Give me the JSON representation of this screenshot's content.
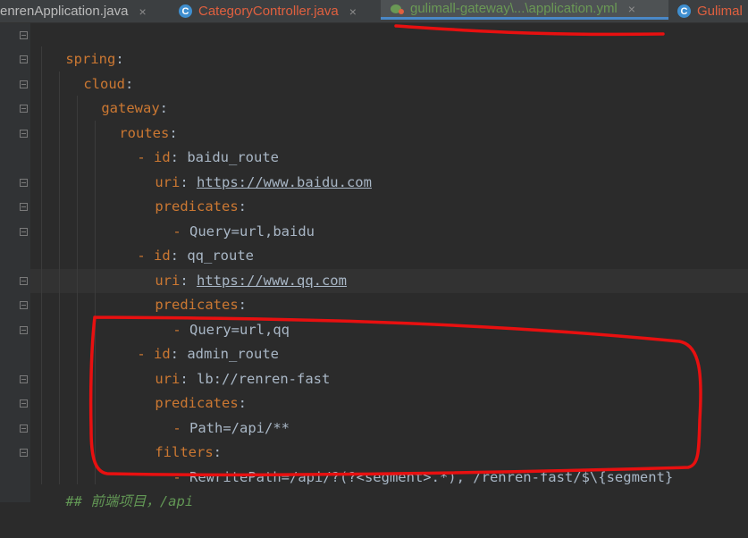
{
  "tabs": [
    {
      "label": "enrenApplication.java",
      "close": "×",
      "icon": "none"
    },
    {
      "label": "CategoryController.java",
      "close": "×",
      "icon": "class-c-icon",
      "icon_text": "C",
      "color": "#e0603f"
    },
    {
      "label": "gulimall-gateway\\...\\application.yml",
      "close": "×",
      "icon": "spring-leaf-icon",
      "color": "#6a9955",
      "active": true
    },
    {
      "label": "Gulimal",
      "icon": "class-c-icon",
      "icon_text": "C",
      "color": "#e0603f"
    }
  ],
  "colors": {
    "background": "#2b2b2b",
    "gutter": "#313335",
    "key": "#cc7832",
    "text": "#a9b7c6",
    "comment": "#629755",
    "annotation": "#e81010"
  },
  "code": {
    "l1": {
      "key": "spring",
      "colon": ":"
    },
    "l2": {
      "key": "cloud",
      "colon": ":"
    },
    "l3": {
      "key": "gateway",
      "colon": ":"
    },
    "l4": {
      "key": "routes",
      "colon": ":"
    },
    "l5": {
      "dash": "- ",
      "key": "id",
      "colon": ": ",
      "value": "baidu_route"
    },
    "l6": {
      "key": "uri",
      "colon": ": ",
      "value": "https://www.baidu.com"
    },
    "l7": {
      "key": "predicates",
      "colon": ":"
    },
    "l8": {
      "dash": "- ",
      "value": "Query=url,baidu"
    },
    "l9": {
      "dash": "- ",
      "key": "id",
      "colon": ": ",
      "value": "qq_route"
    },
    "l10": {
      "key": "uri",
      "colon": ": ",
      "value": "https://www.qq.com"
    },
    "l11": {
      "key": "predicates",
      "colon": ":"
    },
    "l12": {
      "dash": "- ",
      "value": "Query=url,qq"
    },
    "l13": {
      "dash": "- ",
      "key": "id",
      "colon": ": ",
      "value": "admin_route"
    },
    "l14": {
      "key": "uri",
      "colon": ": ",
      "value": "lb://renren-fast"
    },
    "l15": {
      "key": "predicates",
      "colon": ":"
    },
    "l16": {
      "dash": "- ",
      "value": "Path=/api/**"
    },
    "l17": {
      "key": "filters",
      "colon": ":"
    },
    "l18": {
      "dash": "- ",
      "value": "RewritePath=/api/?(?<segment>.*), /renren-fast/$\\{segment}"
    },
    "l19": {
      "comment": "## 前端项目，/api"
    }
  }
}
